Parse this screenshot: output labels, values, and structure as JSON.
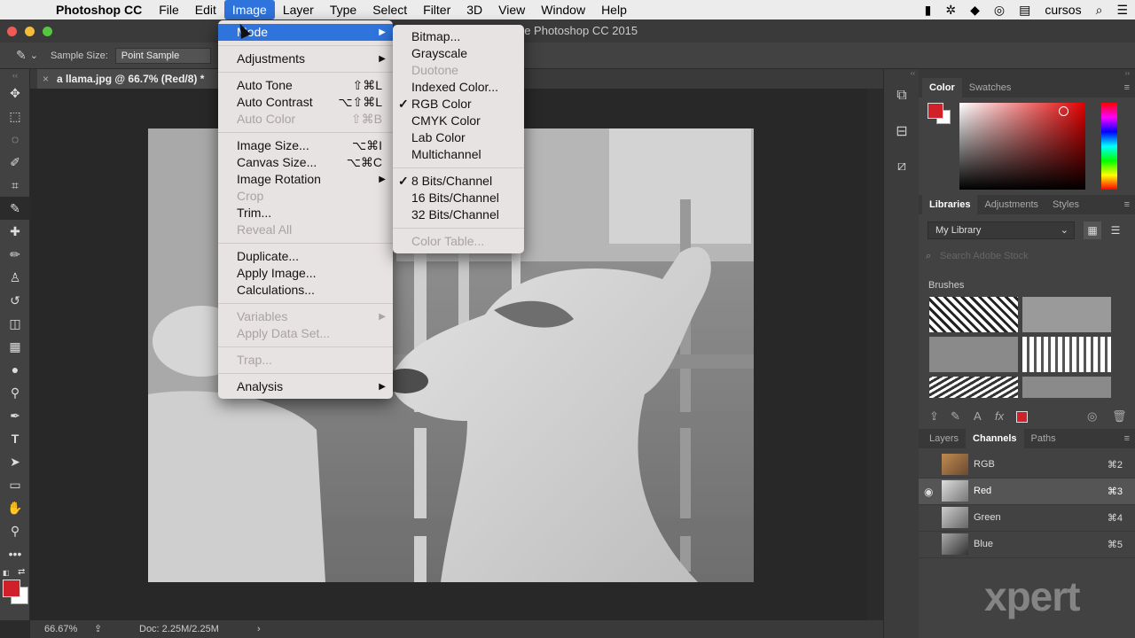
{
  "menubar": {
    "app": "Photoshop CC",
    "items": [
      "File",
      "Edit",
      "Image",
      "Layer",
      "Type",
      "Select",
      "Filter",
      "3D",
      "View",
      "Window",
      "Help"
    ],
    "right_user": "cursos"
  },
  "window": {
    "title": "Adobe Photoshop CC 2015"
  },
  "options": {
    "sample_size_label": "Sample Size:",
    "sample_size_value": "Point Sample"
  },
  "document": {
    "tab_title": "a llama.jpg @ 66.7% (Red/8) *",
    "zoom": "66.67%",
    "doc_info": "Doc: 2.25M/2.25M"
  },
  "image_menu": {
    "items": [
      {
        "label": "Mode",
        "arrow": true,
        "highlight": true
      },
      {
        "sep": true
      },
      {
        "label": "Adjustments",
        "arrow": true
      },
      {
        "sep": true
      },
      {
        "label": "Auto Tone",
        "shortcut": "⇧⌘L"
      },
      {
        "label": "Auto Contrast",
        "shortcut": "⌥⇧⌘L"
      },
      {
        "label": "Auto Color",
        "shortcut": "⇧⌘B",
        "disabled": true
      },
      {
        "sep": true
      },
      {
        "label": "Image Size...",
        "shortcut": "⌥⌘I"
      },
      {
        "label": "Canvas Size...",
        "shortcut": "⌥⌘C"
      },
      {
        "label": "Image Rotation",
        "arrow": true
      },
      {
        "label": "Crop",
        "disabled": true
      },
      {
        "label": "Trim..."
      },
      {
        "label": "Reveal All",
        "disabled": true
      },
      {
        "sep": true
      },
      {
        "label": "Duplicate..."
      },
      {
        "label": "Apply Image..."
      },
      {
        "label": "Calculations..."
      },
      {
        "sep": true
      },
      {
        "label": "Variables",
        "arrow": true,
        "disabled": true
      },
      {
        "label": "Apply Data Set...",
        "disabled": true
      },
      {
        "sep": true
      },
      {
        "label": "Trap...",
        "disabled": true
      },
      {
        "sep": true
      },
      {
        "label": "Analysis",
        "arrow": true
      }
    ]
  },
  "mode_menu": {
    "items": [
      {
        "label": "Bitmap..."
      },
      {
        "label": "Grayscale"
      },
      {
        "label": "Duotone",
        "disabled": true
      },
      {
        "label": "Indexed Color..."
      },
      {
        "label": "RGB Color",
        "checked": true
      },
      {
        "label": "CMYK Color"
      },
      {
        "label": "Lab Color"
      },
      {
        "label": "Multichannel"
      },
      {
        "sep": true
      },
      {
        "label": "8 Bits/Channel",
        "checked": true
      },
      {
        "label": "16 Bits/Channel"
      },
      {
        "label": "32 Bits/Channel"
      },
      {
        "sep": true
      },
      {
        "label": "Color Table...",
        "disabled": true
      }
    ]
  },
  "color_panel": {
    "tabs": [
      "Color",
      "Swatches"
    ],
    "foreground": "#d0202a"
  },
  "libraries_panel": {
    "tabs": [
      "Libraries",
      "Adjustments",
      "Styles"
    ],
    "library": "My Library",
    "search_placeholder": "Search Adobe Stock",
    "section": "Brushes"
  },
  "channels_panel": {
    "tabs": [
      "Layers",
      "Channels",
      "Paths"
    ],
    "channels": [
      {
        "name": "RGB",
        "shortcut": "⌘2"
      },
      {
        "name": "Red",
        "shortcut": "⌘3",
        "selected": true
      },
      {
        "name": "Green",
        "shortcut": "⌘4"
      },
      {
        "name": "Blue",
        "shortcut": "⌘5"
      }
    ]
  },
  "watermark": "xpert"
}
